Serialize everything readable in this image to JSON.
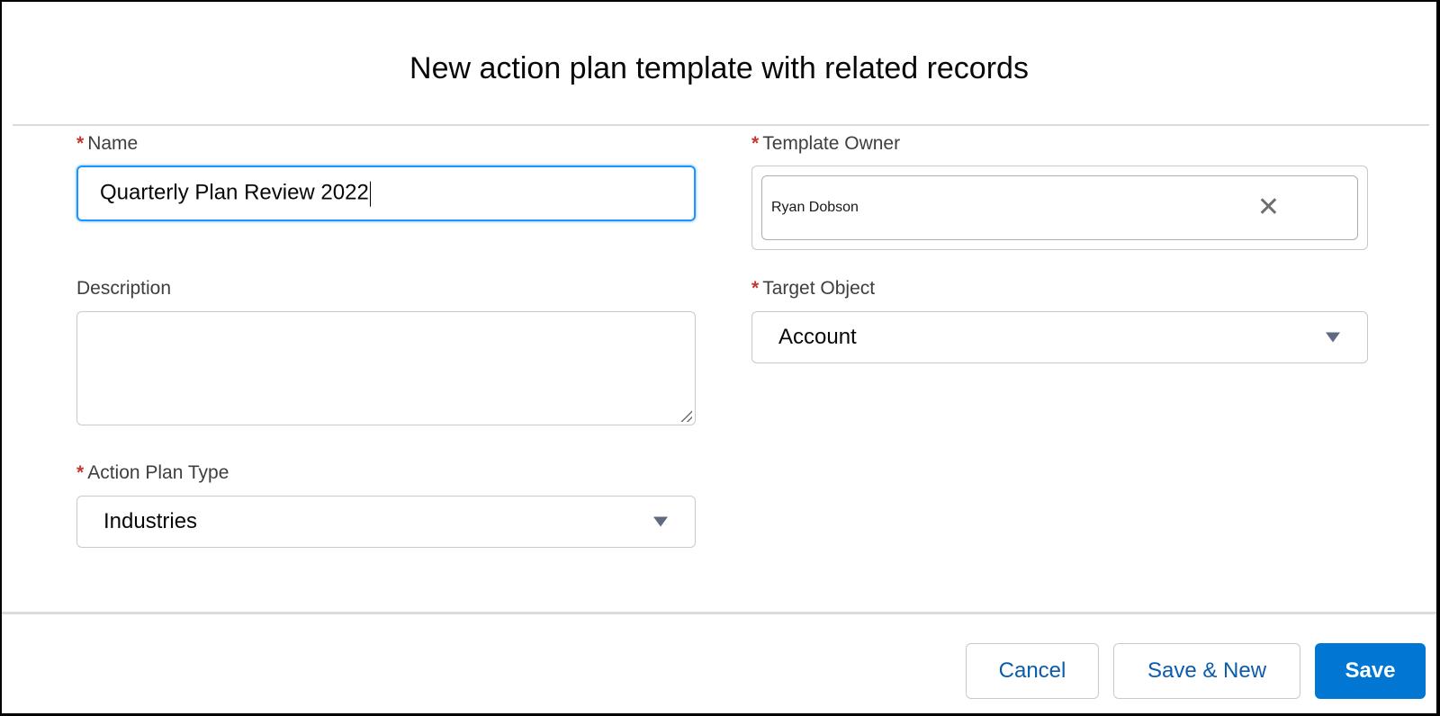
{
  "modal": {
    "title": "New action plan template with related records"
  },
  "form": {
    "required_marker": "*",
    "name": {
      "label": "Name",
      "value": "Quarterly Plan Review 2022",
      "required": true
    },
    "template_owner": {
      "label": "Template Owner",
      "value": "Ryan Dobson",
      "required": true,
      "clear_icon": "✕"
    },
    "description": {
      "label": "Description",
      "value": "",
      "required": false
    },
    "target_object": {
      "label": "Target Object",
      "value": "Account",
      "required": true
    },
    "action_plan_type": {
      "label": "Action Plan Type",
      "value": "Industries",
      "required": true
    }
  },
  "footer": {
    "cancel_label": "Cancel",
    "save_new_label": "Save & New",
    "save_label": "Save"
  },
  "colors": {
    "brand": "#0176d3",
    "required": "#c23934",
    "focus": "#1b96ff"
  }
}
